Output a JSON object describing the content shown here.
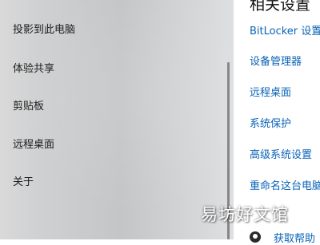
{
  "sidebar": {
    "items": [
      {
        "label": "投影到此电脑"
      },
      {
        "label": "体验共享"
      },
      {
        "label": "剪贴板"
      },
      {
        "label": "远程桌面"
      },
      {
        "label": "关于"
      }
    ]
  },
  "related": {
    "title": "相关设置",
    "links": [
      {
        "label": "BitLocker 设置"
      },
      {
        "label": "设备管理器"
      },
      {
        "label": "远程桌面"
      },
      {
        "label": "系统保护"
      },
      {
        "label": "高级系统设置"
      },
      {
        "label": "重命名这台电脑"
      }
    ],
    "help": {
      "label": "获取帮助",
      "icon": "help-icon"
    }
  },
  "watermark": {
    "text": "易坊好文馆"
  },
  "colors": {
    "link": "#0a63b8",
    "sidebar_bg": "#c8c9cb",
    "text": "#1b1b1b"
  }
}
